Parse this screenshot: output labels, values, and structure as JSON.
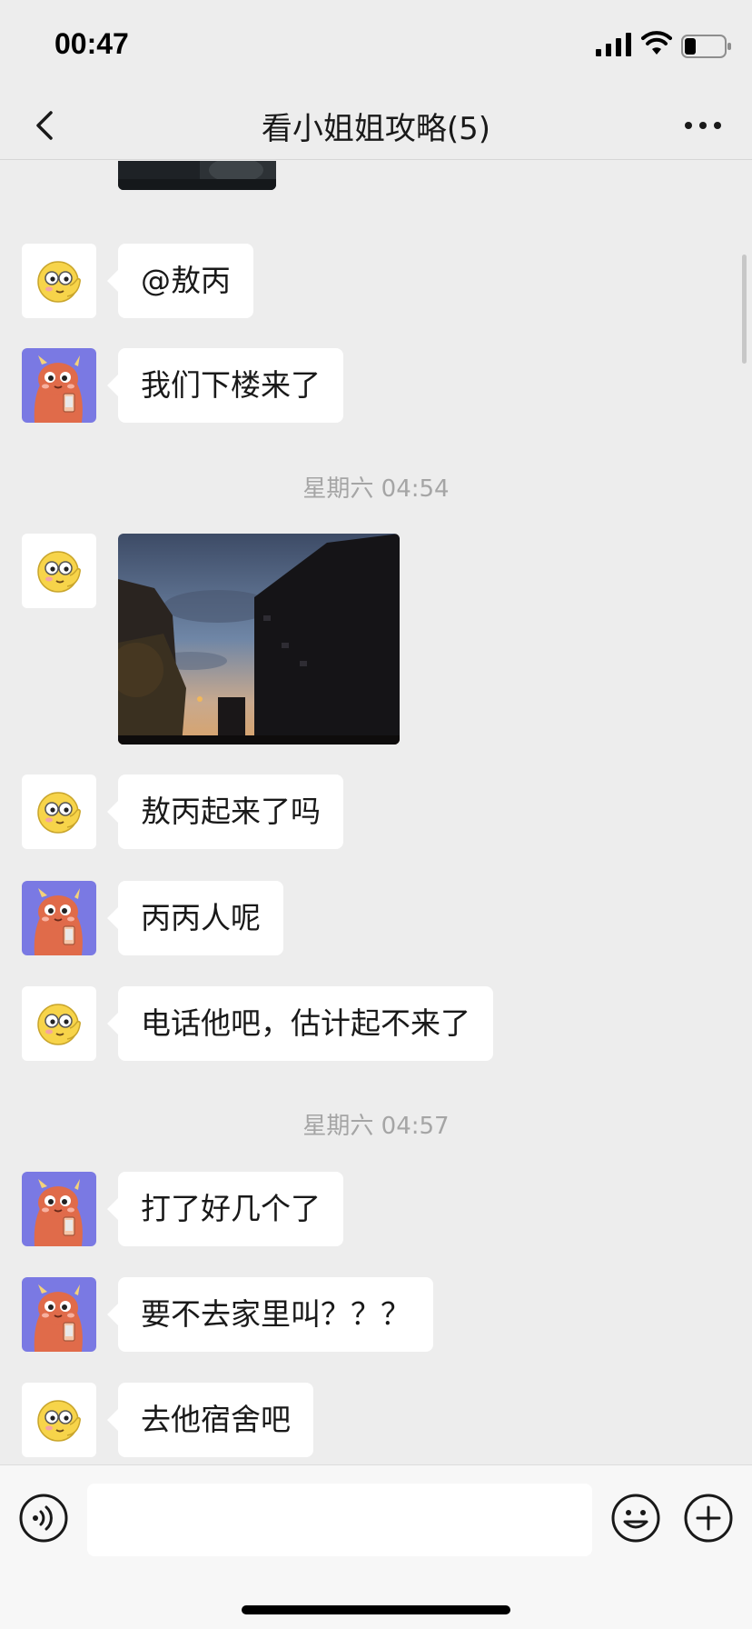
{
  "status_bar": {
    "time": "00:47",
    "icons": [
      "signal-icon",
      "wifi-icon",
      "battery-icon"
    ]
  },
  "nav": {
    "back_icon": "chevron-left-icon",
    "title": "看小姐姐攻略(5)",
    "more_icon": "ellipsis-icon"
  },
  "messages": [
    {
      "type": "image",
      "avatar": "none",
      "content": "dark street photo (partially visible)"
    },
    {
      "type": "text",
      "avatar": "face-emoji-avatar",
      "text": "@敖丙"
    },
    {
      "type": "text",
      "avatar": "devil-avatar",
      "text": "我们下楼来了"
    },
    {
      "type": "time",
      "text": "星期六 04:54"
    },
    {
      "type": "image",
      "avatar": "face-emoji-avatar",
      "content": "dusk sky with buildings"
    },
    {
      "type": "text",
      "avatar": "face-emoji-avatar",
      "text": "敖丙起来了吗"
    },
    {
      "type": "text",
      "avatar": "devil-avatar",
      "text": "丙丙人呢"
    },
    {
      "type": "text",
      "avatar": "face-emoji-avatar",
      "text": "电话他吧，估计起不来了"
    },
    {
      "type": "time",
      "text": "星期六 04:57"
    },
    {
      "type": "text",
      "avatar": "devil-avatar",
      "text": "打了好几个了"
    },
    {
      "type": "text",
      "avatar": "devil-avatar",
      "text": "要不去家里叫？？？"
    },
    {
      "type": "text",
      "avatar": "face-emoji-avatar",
      "text": "去他宿舍吧"
    }
  ],
  "input_bar": {
    "voice_icon": "voice-icon",
    "input_value": "",
    "emoji_icon": "emoji-icon",
    "plus_icon": "plus-icon"
  },
  "colors": {
    "background": "#ededed",
    "bubble": "#ffffff",
    "devil_avatar_bg": "#7a79e3",
    "devil_body": "#e06b4a",
    "timestamp": "#a5a5a5"
  }
}
